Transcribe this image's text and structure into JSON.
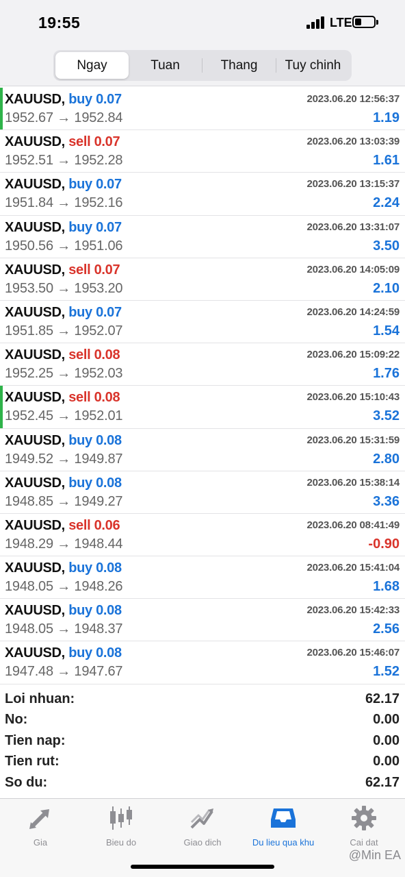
{
  "status_bar": {
    "time": "19:55",
    "network": "LTE"
  },
  "segments": [
    {
      "label": "Ngay",
      "active": true
    },
    {
      "label": "Tuan",
      "active": false
    },
    {
      "label": "Thang",
      "active": false
    },
    {
      "label": "Tuy chinh",
      "active": false
    }
  ],
  "trades": [
    {
      "symbol": "XAUUSD,",
      "dir": "buy 0.07",
      "type": "buy",
      "time": "2023.06.20 12:56:37",
      "prices": "1952.67 → 1952.84",
      "profit": "1.19",
      "marked": true
    },
    {
      "symbol": "XAUUSD,",
      "dir": "sell 0.07",
      "type": "sell",
      "time": "2023.06.20 13:03:39",
      "prices": "1952.51 → 1952.28",
      "profit": "1.61",
      "marked": false
    },
    {
      "symbol": "XAUUSD,",
      "dir": "buy 0.07",
      "type": "buy",
      "time": "2023.06.20 13:15:37",
      "prices": "1951.84 → 1952.16",
      "profit": "2.24",
      "marked": false
    },
    {
      "symbol": "XAUUSD,",
      "dir": "buy 0.07",
      "type": "buy",
      "time": "2023.06.20 13:31:07",
      "prices": "1950.56 → 1951.06",
      "profit": "3.50",
      "marked": false
    },
    {
      "symbol": "XAUUSD,",
      "dir": "sell 0.07",
      "type": "sell",
      "time": "2023.06.20 14:05:09",
      "prices": "1953.50 → 1953.20",
      "profit": "2.10",
      "marked": false
    },
    {
      "symbol": "XAUUSD,",
      "dir": "buy 0.07",
      "type": "buy",
      "time": "2023.06.20 14:24:59",
      "prices": "1951.85 → 1952.07",
      "profit": "1.54",
      "marked": false
    },
    {
      "symbol": "XAUUSD,",
      "dir": "sell 0.08",
      "type": "sell",
      "time": "2023.06.20 15:09:22",
      "prices": "1952.25 → 1952.03",
      "profit": "1.76",
      "marked": false
    },
    {
      "symbol": "XAUUSD,",
      "dir": "sell 0.08",
      "type": "sell",
      "time": "2023.06.20 15:10:43",
      "prices": "1952.45 → 1952.01",
      "profit": "3.52",
      "marked": true
    },
    {
      "symbol": "XAUUSD,",
      "dir": "buy 0.08",
      "type": "buy",
      "time": "2023.06.20 15:31:59",
      "prices": "1949.52 → 1949.87",
      "profit": "2.80",
      "marked": false
    },
    {
      "symbol": "XAUUSD,",
      "dir": "buy 0.08",
      "type": "buy",
      "time": "2023.06.20 15:38:14",
      "prices": "1948.85 → 1949.27",
      "profit": "3.36",
      "marked": false
    },
    {
      "symbol": "XAUUSD,",
      "dir": "sell 0.06",
      "type": "sell",
      "time": "2023.06.20 08:41:49",
      "prices": "1948.29 → 1948.44",
      "profit": "-0.90",
      "marked": false
    },
    {
      "symbol": "XAUUSD,",
      "dir": "buy 0.08",
      "type": "buy",
      "time": "2023.06.20 15:41:04",
      "prices": "1948.05 → 1948.26",
      "profit": "1.68",
      "marked": false
    },
    {
      "symbol": "XAUUSD,",
      "dir": "buy 0.08",
      "type": "buy",
      "time": "2023.06.20 15:42:33",
      "prices": "1948.05 → 1948.37",
      "profit": "2.56",
      "marked": false
    },
    {
      "symbol": "XAUUSD,",
      "dir": "buy 0.08",
      "type": "buy",
      "time": "2023.06.20 15:46:07",
      "prices": "1947.48 → 1947.67",
      "profit": "1.52",
      "marked": false
    }
  ],
  "summary": [
    {
      "label": "Loi nhuan:",
      "value": "62.17"
    },
    {
      "label": "No:",
      "value": "0.00"
    },
    {
      "label": "Tien nap:",
      "value": "0.00"
    },
    {
      "label": "Tien rut:",
      "value": "0.00"
    },
    {
      "label": "So du:",
      "value": "62.17"
    }
  ],
  "tabs": [
    {
      "label": "Gia",
      "icon": "price-arrows-icon",
      "active": false
    },
    {
      "label": "Bieu do",
      "icon": "candlestick-icon",
      "active": false
    },
    {
      "label": "Giao dich",
      "icon": "trade-chart-icon",
      "active": false
    },
    {
      "label": "Du lieu qua khu",
      "icon": "history-inbox-icon",
      "active": true
    },
    {
      "label": "Cai dat",
      "icon": "gear-icon",
      "active": false
    }
  ],
  "watermark": "@Min EA",
  "colors": {
    "buy": "#1a73d9",
    "sell": "#d9342b",
    "accent": "#1a73d9",
    "marker": "#2fb34a"
  }
}
